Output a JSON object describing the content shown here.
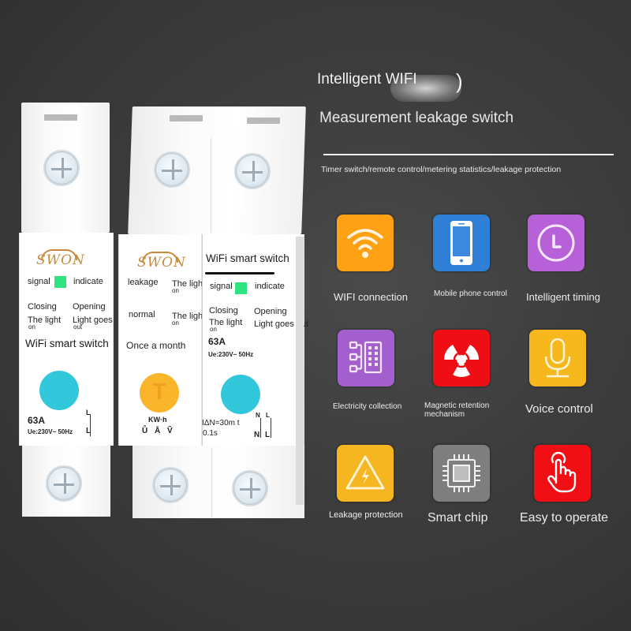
{
  "header": {
    "title_line1": "Intelligent WIFI",
    "title_paren": ")",
    "title_line2": "Measurement leakage switch",
    "subtitle": "Timer switch/remote control/metering statistics/leakage protection"
  },
  "features": [
    {
      "label": "WIFI connection",
      "icon": "wifi-icon",
      "color": "#ffa114"
    },
    {
      "label": "Mobile phone control",
      "icon": "mobile-phone-icon",
      "color": "#2f7fd6"
    },
    {
      "label": "Intelligent timing",
      "icon": "clock-icon",
      "color": "#b761d8"
    },
    {
      "label": "Electricity collection",
      "icon": "meter-network-icon",
      "color": "#a45fcf"
    },
    {
      "label": "Magnetic retention mechanism",
      "label_line1": "Magnetic retention",
      "label_line2": "mechanism",
      "icon": "radiation-icon",
      "color": "#ee0f16"
    },
    {
      "label": "Voice control",
      "icon": "microphone-icon",
      "color": "#f7b81d"
    },
    {
      "label": "Leakage protection",
      "icon": "high-voltage-warning-icon",
      "color": "#f5b622"
    },
    {
      "label": "Smart chip",
      "icon": "chip-icon",
      "color": "#7e7e7e"
    },
    {
      "label": "Easy to operate",
      "icon": "touch-hand-icon",
      "color": "#ef0f14"
    }
  ],
  "breaker_single": {
    "brand": "SWON",
    "signal": "signal",
    "indicate": "indicate",
    "closing": "Closing",
    "opening": "Opening",
    "light_on": "The light",
    "light_on_sub": "on",
    "light_out": "Light goes",
    "light_out_sub": "out",
    "product": "WiFi smart switch",
    "rating": "63A",
    "spec": "Ue:230V~ 50Hz",
    "terminal_top": "L",
    "terminal_bottom": "L",
    "led_color": "#2fe37e",
    "button_color": "#33c7dc"
  },
  "breaker_double": {
    "left": {
      "brand": "SWON",
      "leakage": "leakage",
      "normal": "normal",
      "light_is_on_1": "The light is",
      "light_is_on_2": "The light is",
      "light_sub": "on",
      "test_note": "Once a month",
      "unit": "KW·h",
      "symbols": "Ů Ā Ṽ",
      "button_color": "#fbb52a"
    },
    "right": {
      "product": "WiFi smart switch",
      "signal": "signal",
      "indicate": "indicate",
      "closing": "Closing",
      "opening": "Opening",
      "light_on": "The light",
      "light_on_sub": "on",
      "light_out": "Light goes out",
      "rating": "63A",
      "spec": "Ue:230V~ 50Hz",
      "residual": "IΔN=30m t",
      "trip_time": "0.1s",
      "terminal_n_top": "N",
      "terminal_l_top": "L",
      "terminal_n": "N",
      "terminal_l": "L",
      "led_color": "#2fe37e",
      "button_color": "#33c7dc"
    }
  }
}
